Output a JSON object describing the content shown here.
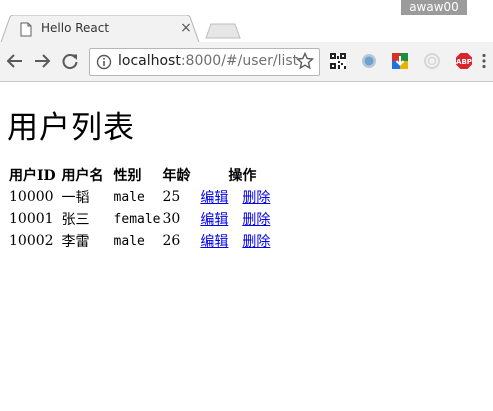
{
  "browser": {
    "tab_title": "Hello React",
    "tab_close_glyph": "×",
    "profile_name": "awaw00",
    "url_host": "localhost",
    "url_path": ":8000/#/user/list"
  },
  "page": {
    "title": "用户列表",
    "table": {
      "headers": [
        "用户ID",
        "用户名",
        "性别",
        "年龄",
        "操作"
      ],
      "rows": [
        {
          "id": "10000",
          "name": "一韬",
          "gender": "male",
          "age": "25",
          "edit": "编辑",
          "delete": "删除"
        },
        {
          "id": "10001",
          "name": "张三",
          "gender": "female",
          "age": "30",
          "edit": "编辑",
          "delete": "删除"
        },
        {
          "id": "10002",
          "name": "李雷",
          "gender": "male",
          "age": "26",
          "edit": "编辑",
          "delete": "删除"
        }
      ]
    }
  },
  "colors": {
    "link": "#0000ee",
    "toolbar": "#f2f2f2",
    "profile_badge": "#9b9b9b",
    "abp_red": "#d8262d"
  },
  "icons": [
    "page-icon",
    "close-icon",
    "back-icon",
    "forward-icon",
    "reload-icon",
    "info-icon",
    "star-icon",
    "qr-code-icon",
    "circle-extension-icon",
    "download-extension-icon",
    "clock-extension-icon",
    "adblock-plus-icon",
    "menu-icon"
  ]
}
